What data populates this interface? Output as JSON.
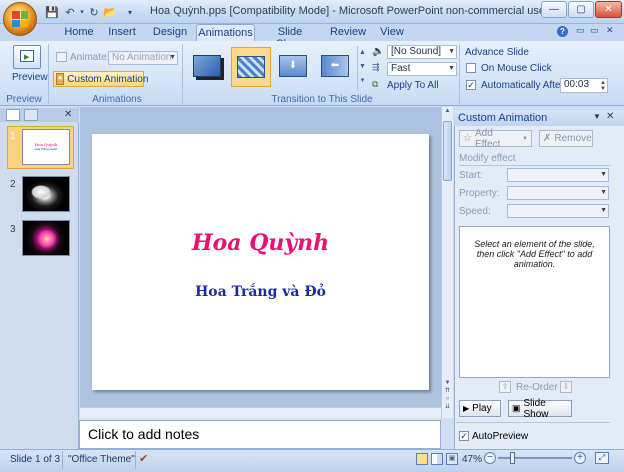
{
  "window": {
    "title": "Hoa Quỳnh.pps [Compatibility Mode] - Microsoft PowerPoint non-commercial use"
  },
  "tabs": [
    "Home",
    "Insert",
    "Design",
    "Animations",
    "Slide Show",
    "Review",
    "View"
  ],
  "active_tab": "Animations",
  "ribbon": {
    "preview": {
      "button_label": "Preview",
      "group_label": "Preview"
    },
    "animations": {
      "animate_label": "Animate:",
      "animate_value": "No Animation",
      "custom_button": "Custom Animation",
      "group_label": "Animations"
    },
    "transition": {
      "sound_value": "[No Sound]",
      "speed_value": "Fast",
      "apply_all_label": "Apply To All",
      "group_label": "Transition to This Slide"
    },
    "advance": {
      "title": "Advance Slide",
      "on_mouse_click": "On Mouse Click",
      "automatically_after": "Automatically After:",
      "time_value": "00:03"
    }
  },
  "thumbnails": [
    {
      "number": "1",
      "title": "Hoa Quỳnh",
      "subtitle": "Hoa Trắng và Đỏ"
    },
    {
      "number": "2"
    },
    {
      "number": "3"
    }
  ],
  "slide": {
    "title": "Hoa Quỳnh",
    "subtitle": "Hoa Trắng và Đỏ"
  },
  "notes_placeholder": "Click to add notes",
  "task_pane": {
    "title": "Custom Animation",
    "add_effect": "Add Effect",
    "remove": "Remove",
    "modify_effect": "Modify effect",
    "start_label": "Start:",
    "property_label": "Property:",
    "speed_label": "Speed:",
    "list_hint": "Select an element of the slide, then click \"Add Effect\" to add animation.",
    "reorder_label": "Re-Order",
    "play_button": "Play",
    "slideshow_button": "Slide Show",
    "autopreview_label": "AutoPreview"
  },
  "status": {
    "slide_info": "Slide 1 of 3",
    "theme": "\"Office Theme\"",
    "zoom": "47%"
  }
}
